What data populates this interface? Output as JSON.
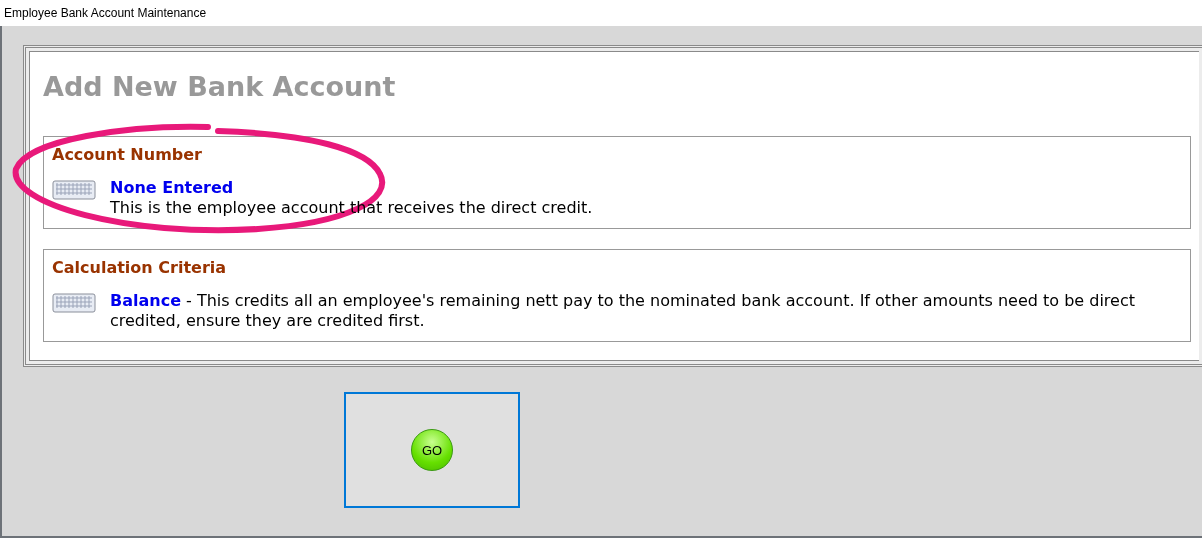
{
  "window": {
    "title": "Employee Bank Account Maintenance"
  },
  "heading": "Add New Bank Account",
  "sections": [
    {
      "title": "Account Number",
      "kind": "stacked",
      "value": "None Entered",
      "description": "This is the employee account that receives the direct credit.",
      "highlighted": true
    },
    {
      "title": "Calculation Criteria",
      "kind": "inline",
      "value": "Balance",
      "description": "- This credits all an employee's remaining nett pay to the nominated bank account. If other amounts need to be direct credited, ensure they are credited first.",
      "highlighted": false
    }
  ],
  "go_button": {
    "label": "GO"
  }
}
